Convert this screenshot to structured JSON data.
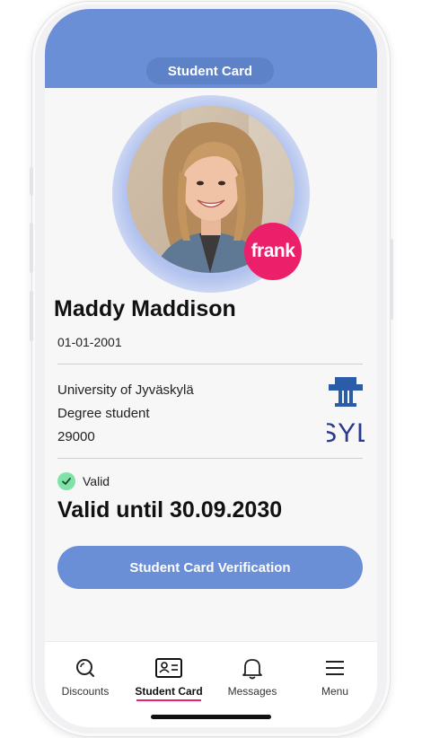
{
  "header": {
    "title": "Student Card"
  },
  "profile": {
    "badge_text": "frank",
    "name": "Maddy Maddison",
    "birth_date": "01-01-2001"
  },
  "university": {
    "name": "University of Jyväskylä",
    "status": "Degree student",
    "student_number": "29000",
    "logo_text": "SYL"
  },
  "validity": {
    "status_label": "Valid",
    "valid_until": "Valid until 30.09.2030"
  },
  "actions": {
    "verify_label": "Student Card Verification"
  },
  "nav": {
    "items": [
      {
        "label": "Discounts",
        "icon": "discounts-icon"
      },
      {
        "label": "Student Card",
        "icon": "student-card-icon",
        "active": true
      },
      {
        "label": "Messages",
        "icon": "bell-icon"
      },
      {
        "label": "Menu",
        "icon": "hamburger-icon"
      }
    ]
  },
  "colors": {
    "accent": "#6a8fd6",
    "brand": "#ec1f6b",
    "valid": "#7fe3a8",
    "logo": "#2a3a8c"
  }
}
